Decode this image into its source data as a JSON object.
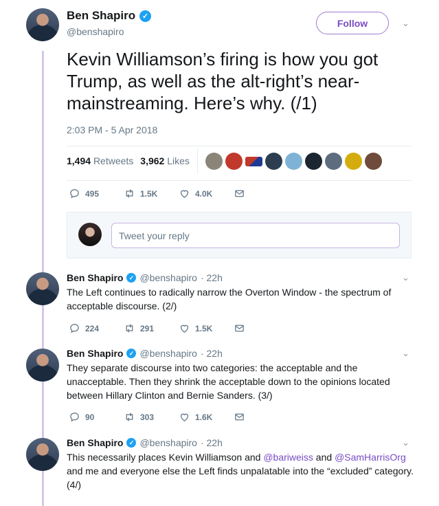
{
  "main_tweet": {
    "name": "Ben Shapiro",
    "handle": "@benshapiro",
    "follow_label": "Follow",
    "text": "Kevin Williamson’s firing is how you got Trump, as well as the alt-right’s near-mainstreaming. Here’s why. (/1)",
    "timestamp": "2:03 PM - 5 Apr 2018",
    "retweets_count": "1,494",
    "retweets_label": "Retweets",
    "likes_count": "3,962",
    "likes_label": "Likes",
    "replies": "495",
    "retweets": "1.5K",
    "likes": "4.0K"
  },
  "reply_box": {
    "placeholder": "Tweet your reply"
  },
  "thread": [
    {
      "name": "Ben Shapiro",
      "handle": "@benshapiro",
      "time": "· 22h",
      "text": "The Left continues to radically narrow the Overton Window - the spectrum of acceptable discourse. (2/)",
      "replies": "224",
      "retweets": "291",
      "likes": "1.5K"
    },
    {
      "name": "Ben Shapiro",
      "handle": "@benshapiro",
      "time": "· 22h",
      "text": "They separate discourse into two categories: the acceptable and the unacceptable. Then they shrink the acceptable down to the opinions located between Hillary Clinton and Bernie Sanders. (3/)",
      "replies": "90",
      "retweets": "303",
      "likes": "1.6K"
    },
    {
      "name": "Ben Shapiro",
      "handle": "@benshapiro",
      "time": "· 22h",
      "text_before": "This necessarily places Kevin Williamson and ",
      "mention1": "@bariweiss",
      "text_mid": " and ",
      "mention2": "@SamHarrisOrg",
      "text_after": " and me and everyone else the Left finds unpalatable into the “excluded” category. (4/)"
    }
  ],
  "colors": {
    "accent": "#794bc4",
    "verified": "#1da1f2",
    "thread_line": "#d6c6ec",
    "muted": "#657786"
  }
}
